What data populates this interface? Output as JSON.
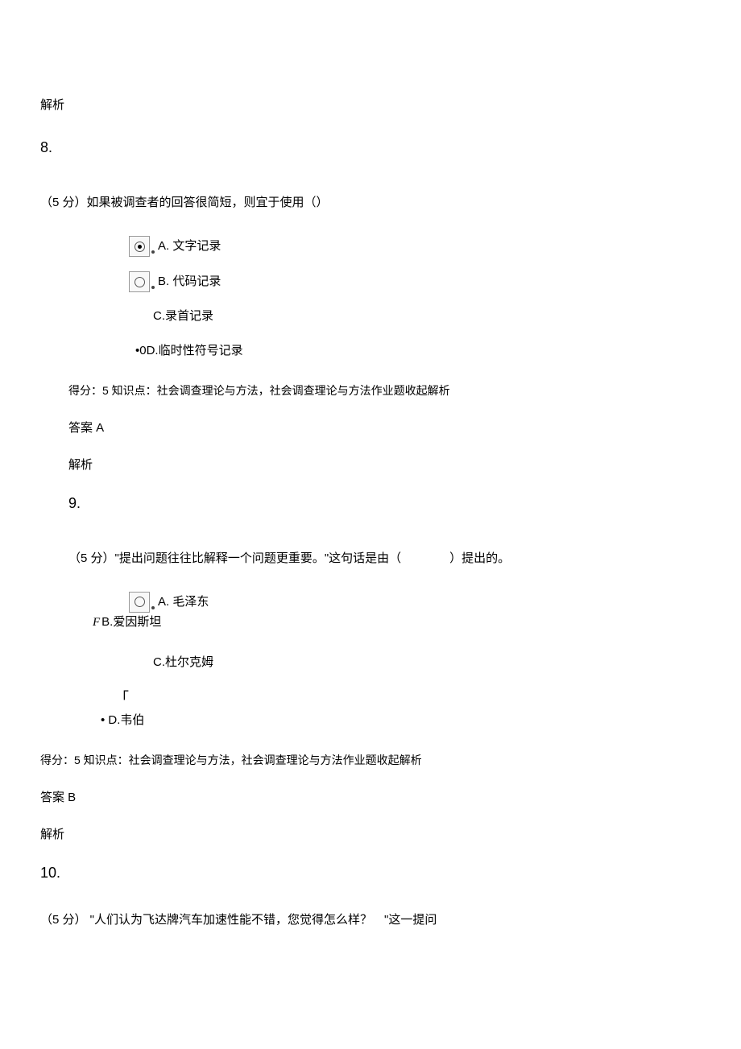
{
  "intro_explain": "解析",
  "q8": {
    "num": "8.",
    "prompt": "（5 分）如果被调查者的回答很简短，则宜于使用（）",
    "optA": "A. 文字记录",
    "optB": "B. 代码记录",
    "optC": "C.录首记录",
    "optD_prefix": "•0",
    "optD": "D.临时性符号记录",
    "score": "得分：5 知识点：社会调查理论与方法，社会调查理论与方法作业题收起解析",
    "answer": "答案 A",
    "explain": "解析"
  },
  "q9": {
    "num": "9.",
    "prompt": "（5 分）\"提出问题往往比解释一个问题更重要。\"这句话是由（　　　　）提出的。",
    "optA": "A. 毛泽东",
    "optB_prefix": "F",
    "optB": "B.爱因斯坦",
    "optC": "C.杜尔克姆",
    "optD_prefix": "「",
    "optD_bullet": "• ",
    "optD": "D.韦伯",
    "score": "得分：5 知识点：社会调查理论与方法，社会调查理论与方法作业题收起解析",
    "answer": "答案 B",
    "explain": "解析"
  },
  "q10": {
    "num": "10.",
    "prompt": "（5 分） \"人们认为飞达牌汽车加速性能不错，您觉得怎么样？　\"这一提问"
  }
}
